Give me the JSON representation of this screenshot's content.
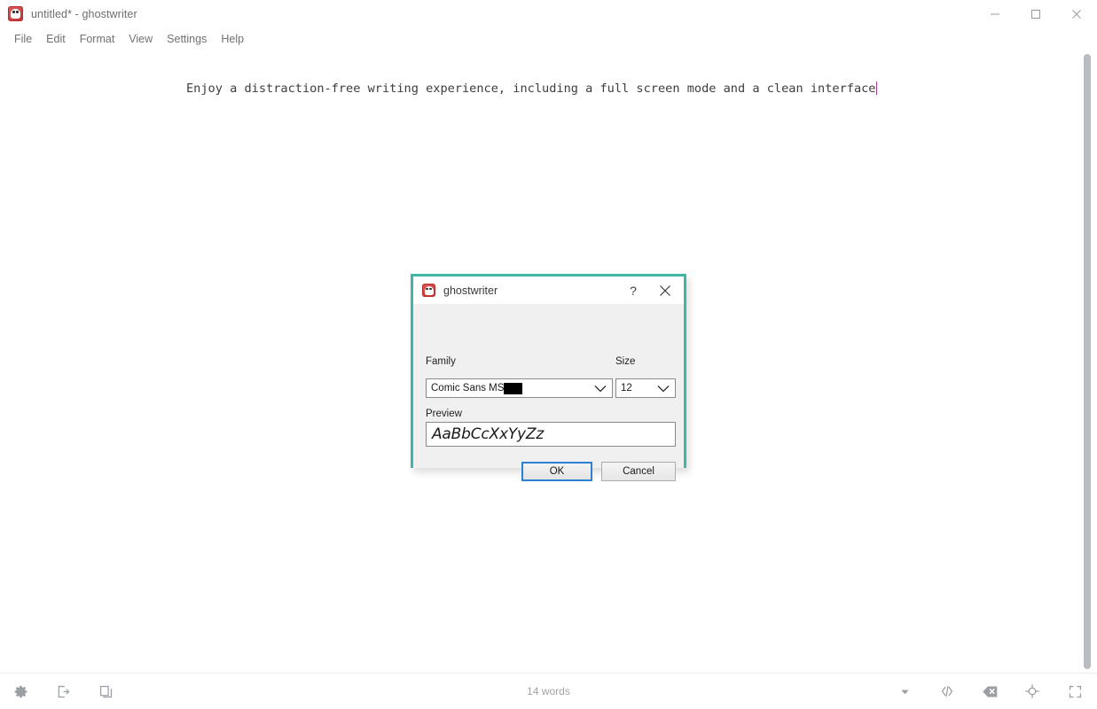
{
  "window": {
    "title": "untitled* - ghostwriter",
    "app_icon": "ghost-icon",
    "controls": {
      "minimize": "minimize-icon",
      "maximize": "maximize-icon",
      "close": "close-icon"
    }
  },
  "menubar": {
    "items": [
      {
        "label": "File"
      },
      {
        "label": "Edit"
      },
      {
        "label": "Format"
      },
      {
        "label": "View"
      },
      {
        "label": "Settings"
      },
      {
        "label": "Help"
      }
    ]
  },
  "editor": {
    "content": "Enjoy a distraction-free writing experience, including a full screen mode and a clean interface",
    "caret_color": "#a0369a"
  },
  "statusbar": {
    "word_count": "14 words",
    "left_icons": [
      {
        "name": "gear-icon"
      },
      {
        "name": "export-icon"
      },
      {
        "name": "copy-icon"
      }
    ],
    "right_icons": [
      {
        "name": "chevron-down-icon"
      },
      {
        "name": "code-icon"
      },
      {
        "name": "backspace-icon"
      },
      {
        "name": "focus-target-icon"
      },
      {
        "name": "fullscreen-icon"
      }
    ]
  },
  "dialog": {
    "title": "ghostwriter",
    "icon": "ghost-icon",
    "help_label": "?",
    "close_label": "✕",
    "border_color": "#3fb7a3",
    "family": {
      "label": "Family",
      "value": "Comic Sans MS"
    },
    "size": {
      "label": "Size",
      "value": "12"
    },
    "preview": {
      "label": "Preview",
      "value": "AaBbCcXxYyZz"
    },
    "buttons": {
      "ok": "OK",
      "cancel": "Cancel"
    }
  }
}
